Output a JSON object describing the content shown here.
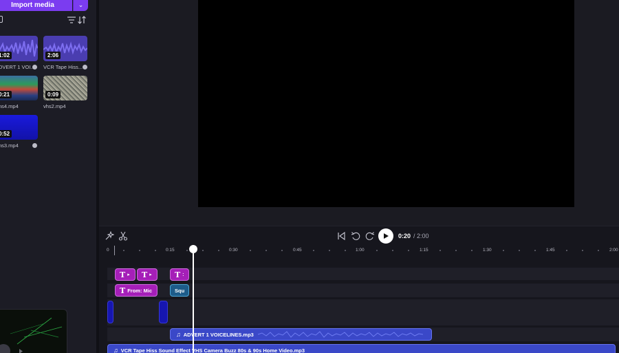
{
  "media": {
    "import_label": "Import media",
    "items": [
      {
        "duration": "1:02",
        "label": "DVERT 1 VOI..."
      },
      {
        "duration": "2:06",
        "label": "VCR Tape Hiss..."
      },
      {
        "duration": "0:21",
        "label": "ns4.mp4"
      },
      {
        "duration": "0:09",
        "label": "vhs2.mp4"
      },
      {
        "duration": "0:52",
        "label": "ns3.mp4"
      }
    ]
  },
  "player": {
    "current_time": "0:20",
    "total_time": "/ 2:00"
  },
  "ruler": {
    "labels": [
      "0",
      "0:15",
      "0:30",
      "0:45",
      "1:00",
      "1:15",
      "1:30",
      "1:45",
      "2:00"
    ]
  },
  "tracks": {
    "text_clip_1_label": "",
    "text_clip_2_label": "",
    "text_clip_3_label": "",
    "text_clip_from_label": "From: Mic",
    "teal_clip_label": "Squ",
    "audio_clip_1_label": "ADVERT 1 VOICELINES.mp3",
    "audio_clip_2_label": "VCR Tape Hiss Sound Effect  VHS Camera Buzz 80s & 90s Home Video.mp3"
  },
  "colors": {
    "accent": "#7b3cf0",
    "text_clip": "#a51fb8",
    "audio_clip": "#3a48c8"
  }
}
